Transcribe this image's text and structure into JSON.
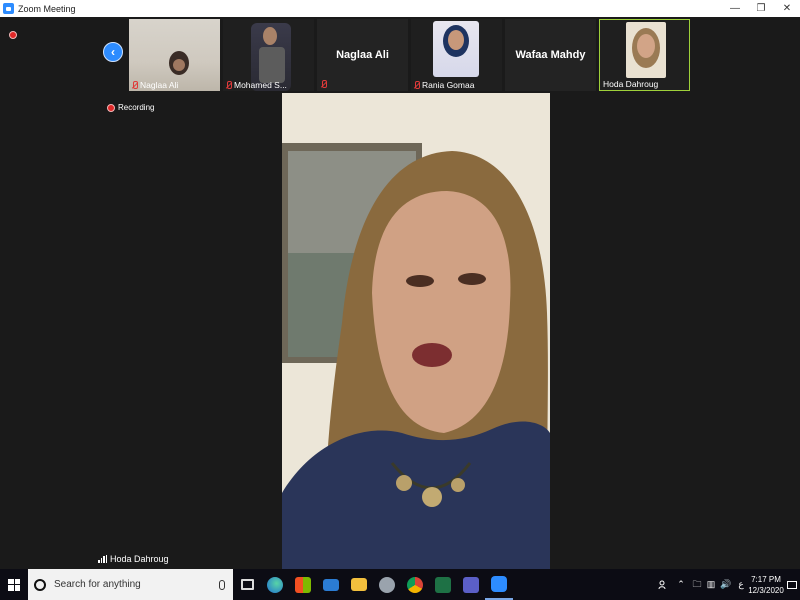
{
  "window": {
    "title": "Zoom Meeting",
    "controls": [
      "—",
      "❐",
      "✕"
    ]
  },
  "gallery": {
    "prev_icon": "chevron-left-icon",
    "tiles": [
      {
        "name": "Naglaa Ali",
        "type": "video",
        "muted": true,
        "active": false
      },
      {
        "name": "Mohamed S...",
        "type": "video",
        "muted": true,
        "active": false
      },
      {
        "name": "Naglaa Ali",
        "type": "name-only",
        "muted": true,
        "active": false
      },
      {
        "name": "Rania Gomaa",
        "type": "video",
        "muted": true,
        "active": false
      },
      {
        "name": "Wafaa Mahdy",
        "type": "name-only",
        "muted": false,
        "active": false
      },
      {
        "name": "Hoda Dahroug",
        "type": "video",
        "muted": false,
        "active": true
      }
    ]
  },
  "recording": {
    "label": "Recording",
    "color": "#e02828"
  },
  "speaker": {
    "name": "Hoda Dahroug"
  },
  "taskbar": {
    "search_placeholder": "Search for anything",
    "apps": [
      "task-view",
      "edge",
      "store",
      "mail",
      "file-explorer",
      "app",
      "chrome",
      "excel",
      "teams",
      "zoom"
    ],
    "tray_symbols": [
      "⌃",
      "🗀",
      "▥",
      "🔊",
      "ع"
    ],
    "time": "7:17 PM",
    "date": "12/3/2020"
  },
  "colors": {
    "accent": "#2d8cff",
    "active_border": "#9fd13a",
    "background": "#1a1a1a",
    "taskbar": "#0c0c14"
  }
}
